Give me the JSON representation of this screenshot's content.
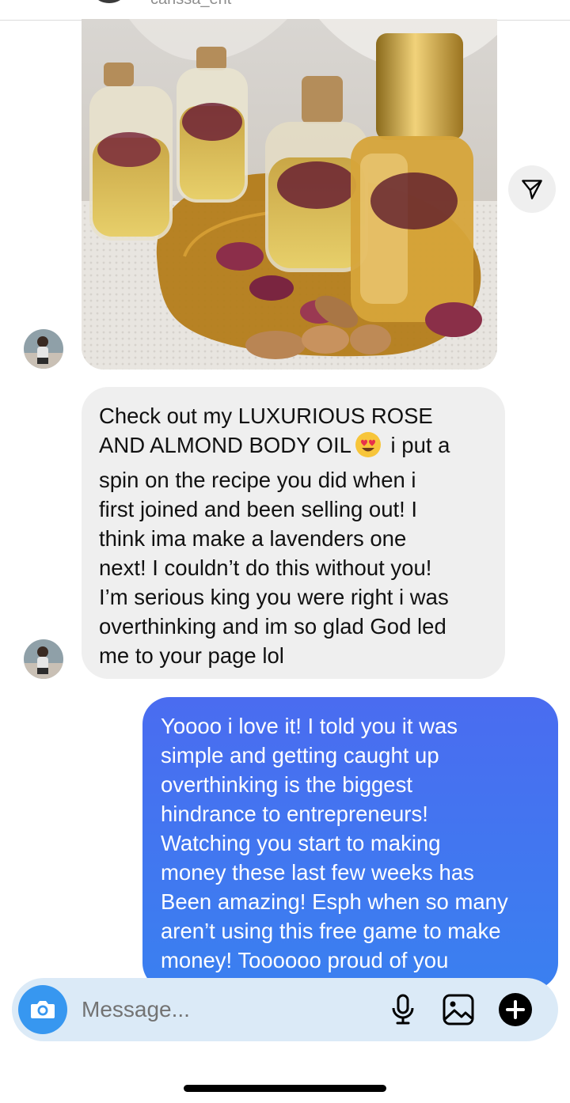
{
  "header": {
    "username": "carissa_ent"
  },
  "thread": {
    "incoming_message": {
      "lines": [
        [
          "Check out my LUXURIOUS ROSE"
        ],
        [
          "AND ALMOND BODY OIL",
          " i put a"
        ],
        [
          "spin on the recipe you did when i"
        ],
        [
          "first joined and been selling out! I"
        ],
        [
          "think ima make a lavenders one"
        ],
        [
          "next! I couldn’t do this without you!"
        ],
        [
          "I’m serious king you were right i was"
        ],
        [
          "overthinking and im so glad God led"
        ],
        [
          "me to your page lol"
        ]
      ],
      "emoji": "heart-eyes-emoji"
    },
    "outgoing_message": {
      "lines": [
        "Yoooo i love it! I told you it was",
        "simple and getting caught up",
        "overthinking is the biggest",
        "hindrance to entrepreneurs!",
        "Watching you start to making",
        "money these last few weeks has",
        "Been amazing! Esph when so many",
        "aren’t using this free game to make",
        "money! Toooooo proud of you"
      ]
    },
    "photo_icon": "paper-plane-icon"
  },
  "composer": {
    "placeholder": "Message...",
    "value": "",
    "icons": [
      "camera-icon",
      "microphone-icon",
      "gallery-icon",
      "plus-icon"
    ]
  },
  "colors": {
    "outgoing_bubble": "#4a6cf0",
    "incoming_bubble": "#efefef",
    "camera_button": "#3797f0",
    "composer_bg": "#dbeaf7"
  }
}
